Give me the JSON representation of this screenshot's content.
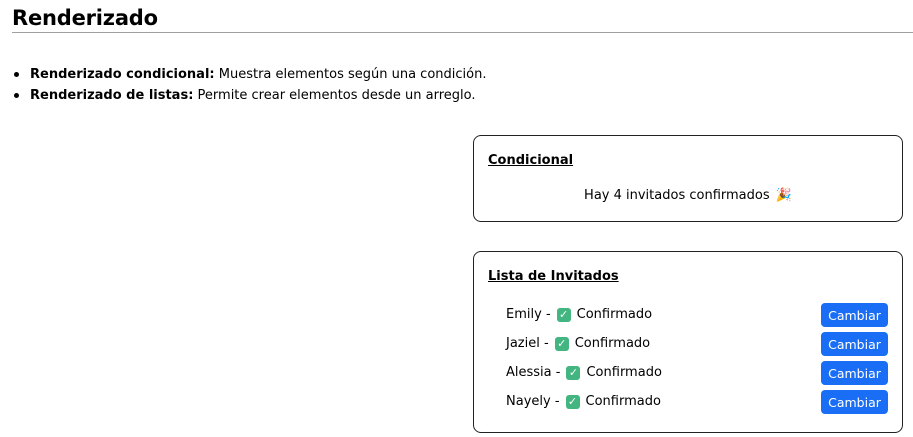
{
  "page": {
    "title": "Renderizado"
  },
  "bullets": [
    {
      "term": "Renderizado condicional:",
      "text": " Muestra elementos según una condición."
    },
    {
      "term": "Renderizado de listas:",
      "text": " Permite crear elementos desde un arreglo."
    }
  ],
  "conditional": {
    "title": "Condicional",
    "message": "Hay 4 invitados confirmados",
    "icon": "party-popper-icon",
    "icon_glyph": "🎉"
  },
  "guest_list": {
    "title": "Lista de Invitados",
    "separator": "-",
    "status_icon": "check-mark-button-icon",
    "status_glyph": "✓",
    "button_color": "#1a6ef5",
    "check_color": "#43b581",
    "guests": [
      {
        "name": "Emily",
        "status": "Confirmado",
        "button": "Cambiar"
      },
      {
        "name": "Jaziel",
        "status": "Confirmado",
        "button": "Cambiar"
      },
      {
        "name": "Alessia",
        "status": "Confirmado",
        "button": "Cambiar"
      },
      {
        "name": "Nayely",
        "status": "Confirmado",
        "button": "Cambiar"
      }
    ]
  }
}
